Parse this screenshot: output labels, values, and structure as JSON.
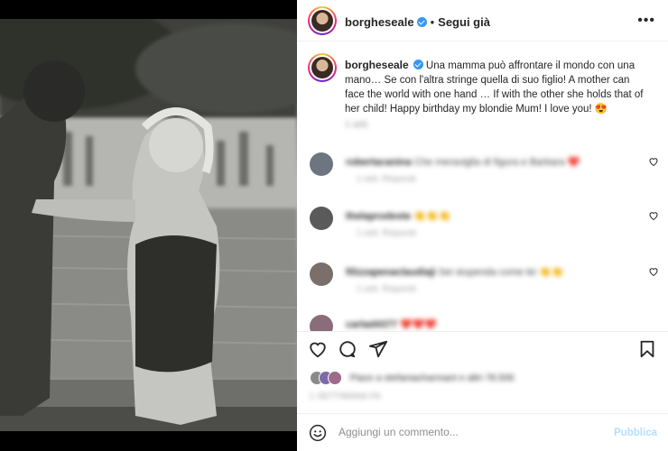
{
  "post": {
    "username": "borgheseale",
    "verified": true,
    "follow_label": "Segui già",
    "more_icon": "more-horizontal-icon"
  },
  "caption": {
    "username": "borgheseale",
    "text": "Una mamma può affrontare il mondo con una mano… Se con l'altra stringe quella di suo figlio! A mother can face the world with one hand … If with the other she holds that of her child! Happy birthday my blondie Mum! I love you! 😍"
  },
  "comments": [
    {
      "username": "robertacanina",
      "text": "Che meraviglia di figura e Barbara",
      "emoji": "❤️",
      "meta": "1 sett.  Rispondi"
    },
    {
      "username": "thelaprodeste",
      "text": "",
      "emoji": "👏👏👏",
      "meta": "1 sett.  Rispondi"
    },
    {
      "username": "filizzapenaclaudiaji",
      "text": "Sei stupenda come lei",
      "emoji": "👏👏",
      "meta": "1 sett.  Rispondi"
    },
    {
      "username": "carlad4377",
      "text": "",
      "emoji": "❤️❤️❤️",
      "meta": ""
    }
  ],
  "actions": {
    "like_icon": "heart-icon",
    "comment_icon": "comment-icon",
    "share_icon": "share-icon",
    "save_icon": "bookmark-icon"
  },
  "likes_text": "Piace a stefaniacharmant e altri 78.506",
  "date": "1 SETTIMANA FA",
  "add_comment": {
    "placeholder": "Aggiungi un commento...",
    "publish_label": "Pubblica"
  },
  "colors": {
    "accent": "#3897f0",
    "publish_disabled": "#b2dffc",
    "text": "#262626",
    "muted": "#8e8e8e"
  }
}
